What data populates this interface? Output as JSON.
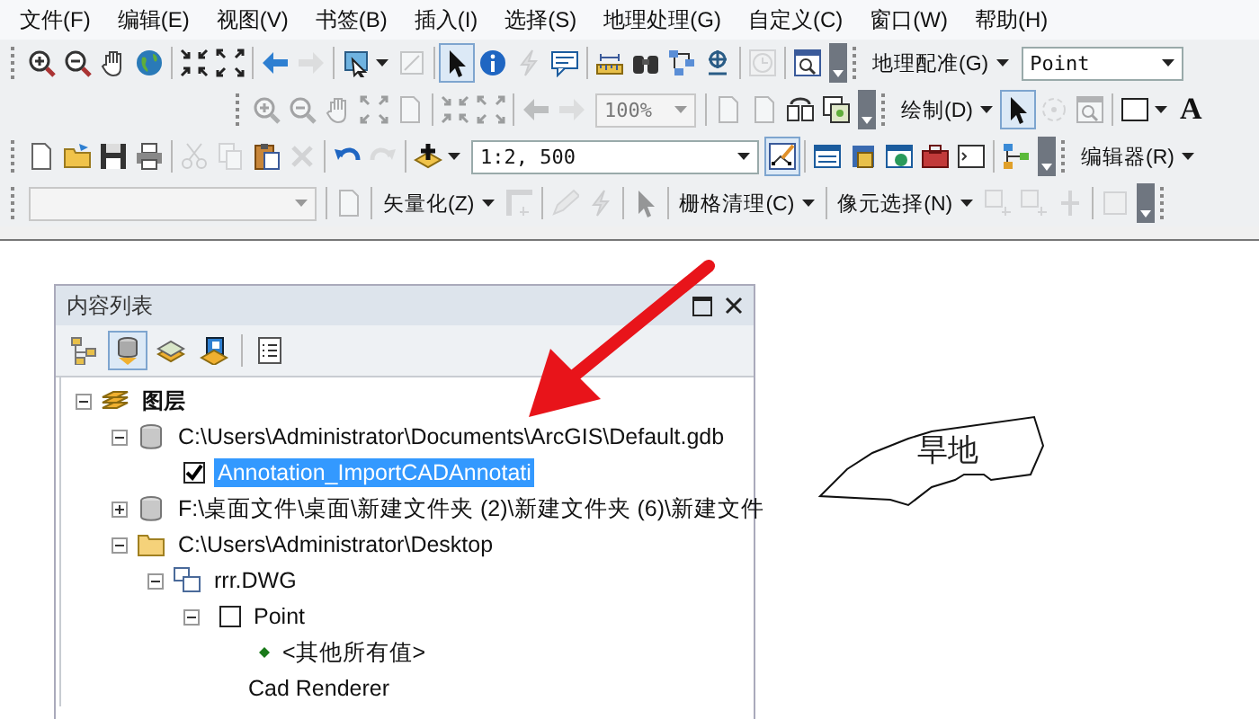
{
  "menu": [
    "文件(F)",
    "编辑(E)",
    "视图(V)",
    "书签(B)",
    "插入(I)",
    "选择(S)",
    "地理处理(G)",
    "自定义(C)",
    "窗口(W)",
    "帮助(H)"
  ],
  "toolbars": [
    {
      "items": [
        {
          "kind": "handle"
        },
        {
          "kind": "icon",
          "disabled": false
        },
        {
          "kind": "icon",
          "disabled": false
        },
        {
          "kind": "icon",
          "disabled": false
        },
        {
          "kind": "icon",
          "disabled": false
        },
        {
          "kind": "sep"
        },
        {
          "kind": "icon",
          "disabled": false
        },
        {
          "kind": "icon",
          "disabled": false
        },
        {
          "kind": "sep"
        },
        {
          "kind": "icon",
          "disabled": false
        },
        {
          "kind": "icon",
          "disabled": true
        },
        {
          "kind": "sep"
        },
        {
          "kind": "icon",
          "disabled": false
        },
        {
          "kind": "caret"
        },
        {
          "kind": "icon",
          "disabled": true
        },
        {
          "kind": "sep"
        },
        {
          "kind": "icon",
          "disabled": false,
          "pressed": true
        },
        {
          "kind": "icon",
          "disabled": false
        },
        {
          "kind": "icon",
          "disabled": true
        },
        {
          "kind": "icon",
          "disabled": false
        },
        {
          "kind": "sep"
        },
        {
          "kind": "icon",
          "disabled": false
        },
        {
          "kind": "icon",
          "disabled": false
        },
        {
          "kind": "icon",
          "disabled": false
        },
        {
          "kind": "icon",
          "disabled": false
        },
        {
          "kind": "sep"
        },
        {
          "kind": "icon",
          "disabled": true
        },
        {
          "kind": "sep"
        },
        {
          "kind": "icon",
          "disabled": false
        },
        {
          "kind": "overflow"
        },
        {
          "kind": "handle"
        },
        {
          "kind": "dropdown",
          "label": "地理配准(G)"
        },
        {
          "kind": "combo",
          "value": "Point",
          "disabled": false
        }
      ]
    },
    {
      "items": [
        {
          "kind": "handle"
        },
        {
          "kind": "icon",
          "disabled": true
        },
        {
          "kind": "icon",
          "disabled": true
        },
        {
          "kind": "icon",
          "disabled": true
        },
        {
          "kind": "icon",
          "disabled": true
        },
        {
          "kind": "icon",
          "disabled": true
        },
        {
          "kind": "sep"
        },
        {
          "kind": "icon",
          "disabled": true
        },
        {
          "kind": "icon",
          "disabled": true
        },
        {
          "kind": "sep"
        },
        {
          "kind": "icon",
          "disabled": true
        },
        {
          "kind": "icon",
          "disabled": true
        },
        {
          "kind": "combo",
          "value": "100%",
          "disabled": true
        },
        {
          "kind": "sep"
        },
        {
          "kind": "icon",
          "disabled": true
        },
        {
          "kind": "icon",
          "disabled": true
        },
        {
          "kind": "icon",
          "disabled": false
        },
        {
          "kind": "icon",
          "disabled": false
        },
        {
          "kind": "overflow"
        },
        {
          "kind": "handle"
        },
        {
          "kind": "dropdown",
          "label": "绘制(D)"
        },
        {
          "kind": "icon",
          "disabled": false,
          "pressed": true
        },
        {
          "kind": "icon",
          "disabled": true
        },
        {
          "kind": "icon",
          "disabled": true
        },
        {
          "kind": "sep"
        },
        {
          "kind": "icon",
          "disabled": false
        },
        {
          "kind": "caret"
        },
        {
          "kind": "text",
          "label": "A"
        }
      ]
    },
    {
      "items": [
        {
          "kind": "handle"
        },
        {
          "kind": "icon",
          "disabled": false
        },
        {
          "kind": "icon",
          "disabled": false
        },
        {
          "kind": "icon",
          "disabled": false
        },
        {
          "kind": "icon",
          "disabled": false
        },
        {
          "kind": "sep"
        },
        {
          "kind": "icon",
          "disabled": true
        },
        {
          "kind": "icon",
          "disabled": true
        },
        {
          "kind": "icon",
          "disabled": false
        },
        {
          "kind": "icon",
          "disabled": true
        },
        {
          "kind": "sep"
        },
        {
          "kind": "icon",
          "disabled": false
        },
        {
          "kind": "icon",
          "disabled": true
        },
        {
          "kind": "sep"
        },
        {
          "kind": "icon",
          "disabled": false
        },
        {
          "kind": "caret"
        },
        {
          "kind": "combo",
          "value": "1:2, 500",
          "disabled": false
        },
        {
          "kind": "icon",
          "disabled": false,
          "pressed": true
        },
        {
          "kind": "sep"
        },
        {
          "kind": "icon",
          "disabled": false
        },
        {
          "kind": "icon",
          "disabled": false
        },
        {
          "kind": "icon",
          "disabled": false
        },
        {
          "kind": "icon",
          "disabled": false
        },
        {
          "kind": "icon",
          "disabled": false
        },
        {
          "kind": "sep"
        },
        {
          "kind": "icon",
          "disabled": false
        },
        {
          "kind": "overflow"
        },
        {
          "kind": "handle"
        },
        {
          "kind": "dropdown",
          "label": "编辑器(R)"
        }
      ]
    },
    {
      "items": [
        {
          "kind": "handle"
        },
        {
          "kind": "combo",
          "value": "",
          "disabled": true
        },
        {
          "kind": "sep"
        },
        {
          "kind": "icon",
          "disabled": true
        },
        {
          "kind": "sep"
        },
        {
          "kind": "dropdown",
          "label": "矢量化(Z)"
        },
        {
          "kind": "icon",
          "disabled": true
        },
        {
          "kind": "sep"
        },
        {
          "kind": "icon",
          "disabled": true
        },
        {
          "kind": "icon",
          "disabled": true
        },
        {
          "kind": "sep"
        },
        {
          "kind": "icon",
          "disabled": true
        },
        {
          "kind": "sep"
        },
        {
          "kind": "dropdown",
          "label": "栅格清理(C)"
        },
        {
          "kind": "sep"
        },
        {
          "kind": "dropdown",
          "label": "像元选择(N)"
        },
        {
          "kind": "icon",
          "disabled": true
        },
        {
          "kind": "icon",
          "disabled": true
        },
        {
          "kind": "icon",
          "disabled": true
        },
        {
          "kind": "sep"
        },
        {
          "kind": "icon",
          "disabled": true
        },
        {
          "kind": "overflow"
        },
        {
          "kind": "handle"
        }
      ]
    }
  ],
  "contents": {
    "title": "内容列表",
    "view_tabs": [
      {
        "selected": false
      },
      {
        "selected": true
      },
      {
        "selected": false
      },
      {
        "selected": false
      }
    ],
    "tree": [
      {
        "label": "图层",
        "kind": "group",
        "expanded": true,
        "children": [
          {
            "label": "C:\\Users\\Administrator\\Documents\\ArcGIS\\Default.gdb",
            "kind": "database",
            "expanded": true,
            "children": [
              {
                "label": "Annotation_ImportCADAnnotati",
                "kind": "layer",
                "checked": true,
                "selected": true
              }
            ]
          },
          {
            "label": "F:\\桌面文件\\桌面\\新建文件夹 (2)\\新建文件夹 (6)\\新建文件",
            "kind": "database",
            "expanded": false
          },
          {
            "label": "C:\\Users\\Administrator\\Desktop",
            "kind": "folder",
            "expanded": true,
            "children": [
              {
                "label": "rrr.DWG",
                "kind": "cad",
                "expanded": true,
                "children": [
                  {
                    "label": "Point",
                    "kind": "layer",
                    "checked": false,
                    "selected": false,
                    "expanded": true,
                    "children": [
                      {
                        "label": "<其他所有值>",
                        "kind": "symbol",
                        "color": "#1a7a1a"
                      },
                      {
                        "label": "Cad Renderer",
                        "kind": "text"
                      }
                    ]
                  }
                ]
              }
            ]
          }
        ]
      }
    ]
  },
  "map": {
    "label": "旱地"
  }
}
